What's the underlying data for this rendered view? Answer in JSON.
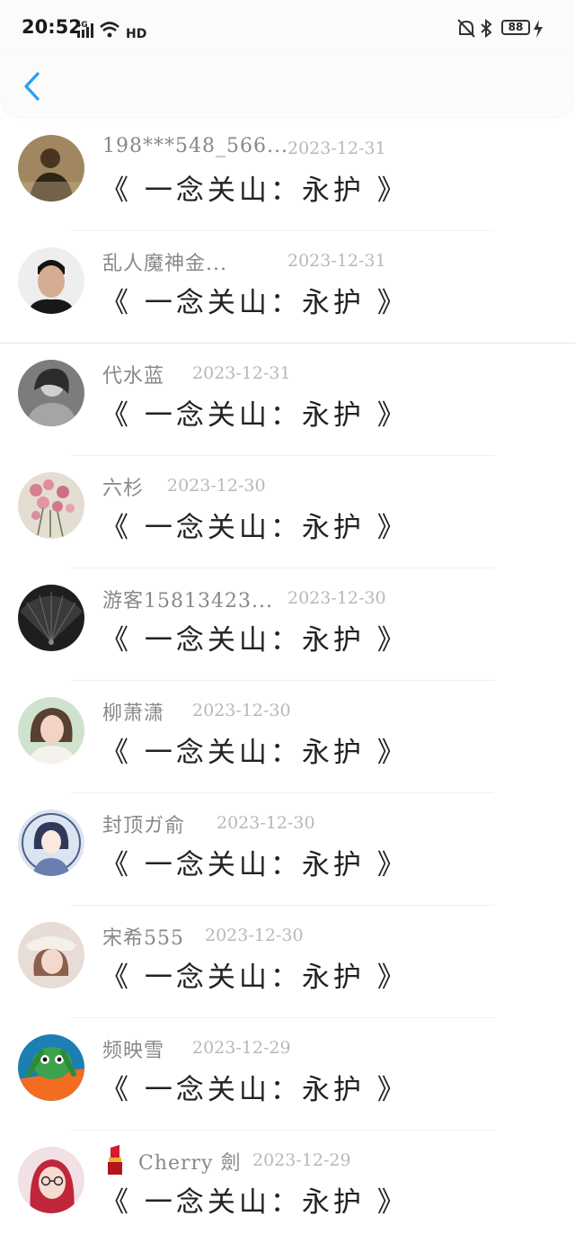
{
  "status_bar": {
    "time": "20:52",
    "network": "4G",
    "hd": "HD",
    "battery": "88"
  },
  "nav": {
    "back_icon": "chevron-left-icon"
  },
  "colors": {
    "accent": "#2a9df4",
    "name": "#888888",
    "date": "#b8b8b8",
    "title": "#222222"
  },
  "items": [
    {
      "name": "198***548_566...",
      "date": "2023-12-31",
      "title": "《 一念关山：永护 》"
    },
    {
      "name": "乱人魔神金...",
      "date": "2023-12-31",
      "title": "《 一念关山：永护 》"
    },
    {
      "name": "代水蓝",
      "date": "2023-12-31",
      "title": "《 一念关山：永护 》"
    },
    {
      "name": "六杉",
      "date": "2023-12-30",
      "title": "《 一念关山：永护 》"
    },
    {
      "name": "游客15813423...",
      "date": "2023-12-30",
      "title": "《 一念关山：永护 》"
    },
    {
      "name": "柳萧潇",
      "date": "2023-12-30",
      "title": "《 一念关山：永护 》"
    },
    {
      "name": "封顶ガ俞",
      "date": "2023-12-30",
      "title": "《 一念关山：永护 》"
    },
    {
      "name": "宋希555",
      "date": "2023-12-30",
      "title": "《 一念关山：永护 》"
    },
    {
      "name": "频映雪",
      "date": "2023-12-29",
      "title": "《 一念关山：永护 》"
    },
    {
      "name": "Cherry 劍",
      "date": "2023-12-29",
      "title": "《 一念关山：永护 》"
    }
  ]
}
